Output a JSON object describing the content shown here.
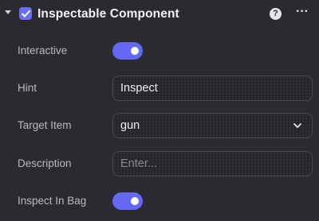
{
  "component": {
    "title": "Inspectable Component",
    "help_icon": "help-circle-icon",
    "more_icon": "more-horizontal-icon",
    "enabled": true
  },
  "fields": {
    "interactive": {
      "label": "Interactive",
      "value": true
    },
    "hint": {
      "label": "Hint",
      "value": "Inspect"
    },
    "target_item": {
      "label": "Target Item",
      "value": "gun"
    },
    "description": {
      "label": "Description",
      "value": "",
      "placeholder": "Enter..."
    },
    "inspect_in_bag": {
      "label": "Inspect In Bag",
      "value": true
    }
  },
  "colors": {
    "accent": "#6468f2",
    "background": "#2a2a30",
    "field_border": "#4a4a54"
  }
}
